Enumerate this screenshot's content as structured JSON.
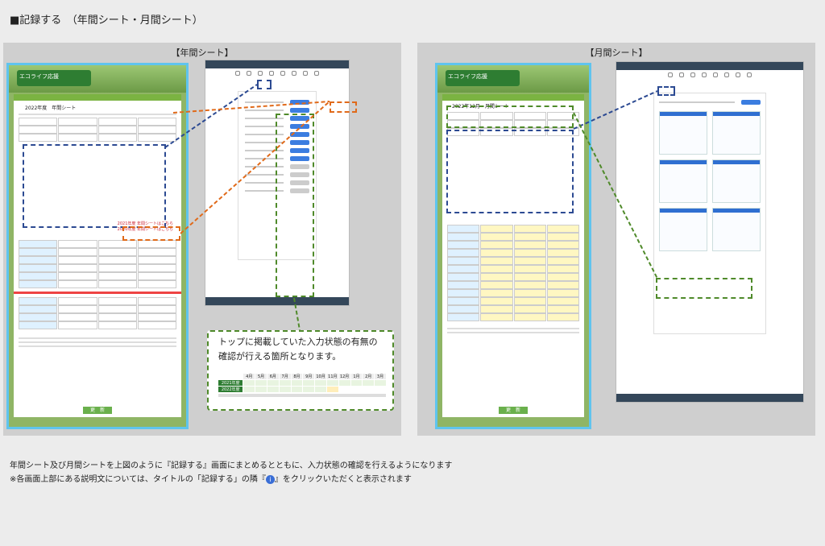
{
  "header": {
    "title": "■記録する　（年間シート・月間シート）"
  },
  "panels": {
    "left_label": "【年間シート】",
    "right_label": "【月間シート】"
  },
  "old_site": {
    "logo_text": "エコライフ応援",
    "year_title": "2022年度　年間シート",
    "month_title": "2022年12月　月間シート",
    "submit": "更　新",
    "links_line1": "2021年度 年間シートはこちら",
    "links_line2": "2020年度 年間シートはこちら"
  },
  "callout": {
    "text": "トップに掲載していた入力状態の有無の確認が行える箇所となります。",
    "mini_table_header": [
      "4月",
      "5月",
      "6月",
      "7月",
      "8月",
      "9月",
      "10月",
      "11月",
      "12月",
      "1月",
      "2月",
      "3月"
    ],
    "mini_table_rows": [
      "2021年度",
      "2022年度"
    ]
  },
  "footer": {
    "line1": "年間シート及び月間シートを上図のように『記録する』画面にまとめるとともに、入力状態の確認を行えるようになります",
    "line2_before": "※各画面上部にある説明文については、タイトルの「記録する」の隣『",
    "icon": "i",
    "line2_after": "』をクリックいただくと表示されます"
  },
  "colors": {
    "panel_bg": "#cfcfcf",
    "accent_blue": "#2c4a92",
    "accent_orange": "#e06a1a",
    "accent_green": "#4f8a2a",
    "frame_blue": "#5fc4ee"
  }
}
